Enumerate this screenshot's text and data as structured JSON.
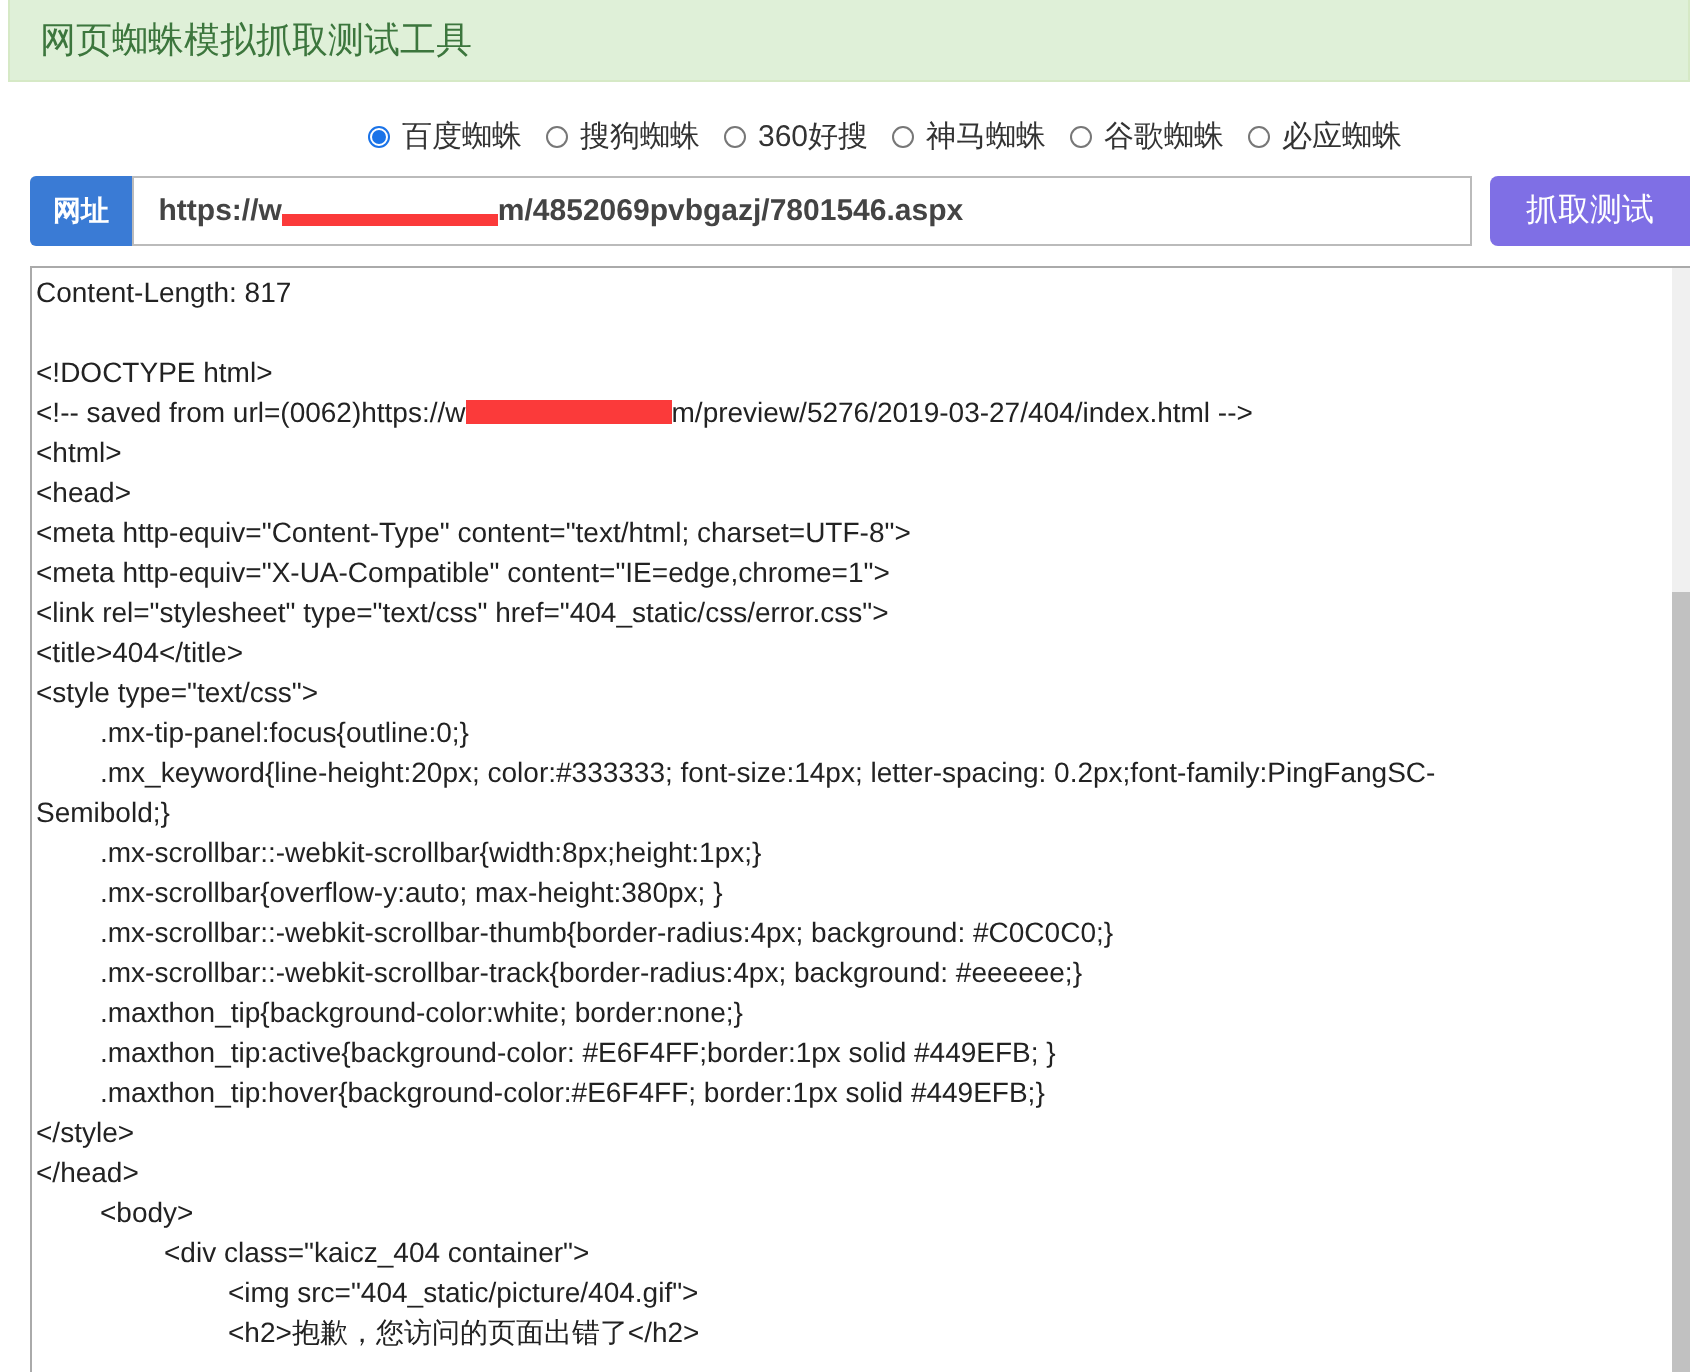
{
  "header": {
    "title": "网页蜘蛛模拟抓取测试工具"
  },
  "spiders": [
    {
      "label": "百度蜘蛛",
      "selected": true
    },
    {
      "label": "搜狗蜘蛛",
      "selected": false
    },
    {
      "label": "360好搜",
      "selected": false
    },
    {
      "label": "神马蜘蛛",
      "selected": false
    },
    {
      "label": "谷歌蜘蛛",
      "selected": false
    },
    {
      "label": "必应蜘蛛",
      "selected": false
    }
  ],
  "url_bar": {
    "label": "网址",
    "value_start": "https://w",
    "value_end": "m/4852069pvbgazj/7801546.aspx",
    "submit": "抓取测试"
  },
  "output": {
    "lines": [
      {
        "text": "Content-Length: 817"
      },
      {
        "kind": "blank"
      },
      {
        "text": "<!DOCTYPE html>"
      },
      {
        "text": "<!-- saved from url=(0062)https://w",
        "redacted_tail": "m/preview/5276/2019-03-27/404/index.html -->"
      },
      {
        "text": "<html>"
      },
      {
        "text": "<head>"
      },
      {
        "text": "<meta http-equiv=\"Content-Type\" content=\"text/html; charset=UTF-8\">"
      },
      {
        "text": "<meta http-equiv=\"X-UA-Compatible\" content=\"IE=edge,chrome=1\">"
      },
      {
        "text": "<link rel=\"stylesheet\" type=\"text/css\" href=\"404_static/css/error.css\">"
      },
      {
        "text": "<title>404</title>"
      },
      {
        "text": "<style type=\"text/css\">"
      },
      {
        "text": "\t.mx-tip-panel:focus{outline:0;}"
      },
      {
        "text": "\t.mx_keyword{line-height:20px; color:#333333; font-size:14px; letter-spacing: 0.2px;font-family:PingFangSC-Semibold;}"
      },
      {
        "text": "\t.mx-scrollbar::-webkit-scrollbar{width:8px;height:1px;}"
      },
      {
        "text": "\t.mx-scrollbar{overflow-y:auto; max-height:380px; }"
      },
      {
        "text": "\t.mx-scrollbar::-webkit-scrollbar-thumb{border-radius:4px; background: #C0C0C0;}"
      },
      {
        "text": "\t.mx-scrollbar::-webkit-scrollbar-track{border-radius:4px; background: #eeeeee;}"
      },
      {
        "text": "\t.maxthon_tip{background-color:white; border:none;}"
      },
      {
        "text": "\t.maxthon_tip:active{background-color: #E6F4FF;border:1px solid #449EFB; }"
      },
      {
        "text": "\t.maxthon_tip:hover{background-color:#E6F4FF; border:1px solid #449EFB;}"
      },
      {
        "text": "</style>"
      },
      {
        "text": "</head>"
      },
      {
        "text": "\t<body>"
      },
      {
        "text": "\t\t<div class=\"kaicz_404 container\">"
      },
      {
        "text": "\t\t\t<img src=\"404_static/picture/404.gif\">"
      },
      {
        "text": "\t\t\t<h2>抱歉，您访问的页面出错了</h2>"
      }
    ]
  }
}
